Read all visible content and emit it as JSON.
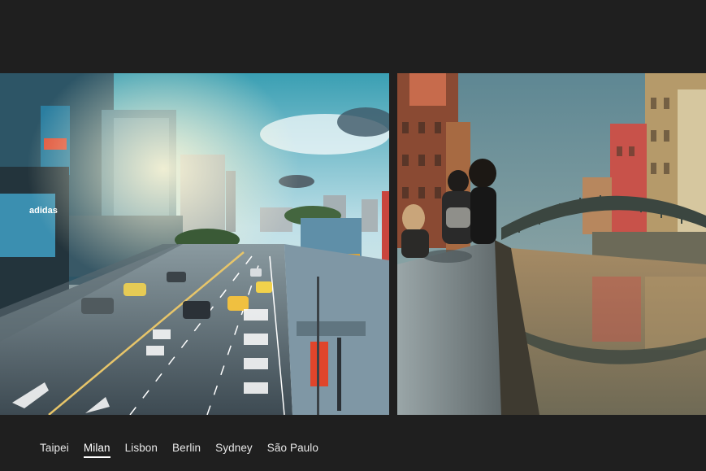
{
  "gallery": {
    "photos": [
      {
        "city": "Taipei",
        "scene": "city-street"
      },
      {
        "city": "Milan",
        "scene": "canal-bridge"
      }
    ]
  },
  "tabs": [
    {
      "label": "Taipei",
      "active": false
    },
    {
      "label": "Milan",
      "active": true
    },
    {
      "label": "Lisbon",
      "active": false
    },
    {
      "label": "Berlin",
      "active": false
    },
    {
      "label": "Sydney",
      "active": false
    },
    {
      "label": "São Paulo",
      "active": false
    }
  ],
  "colors": {
    "background": "#1f1f1f",
    "tab_text": "#e8e8e8",
    "tab_active_underline": "#ffffff"
  }
}
